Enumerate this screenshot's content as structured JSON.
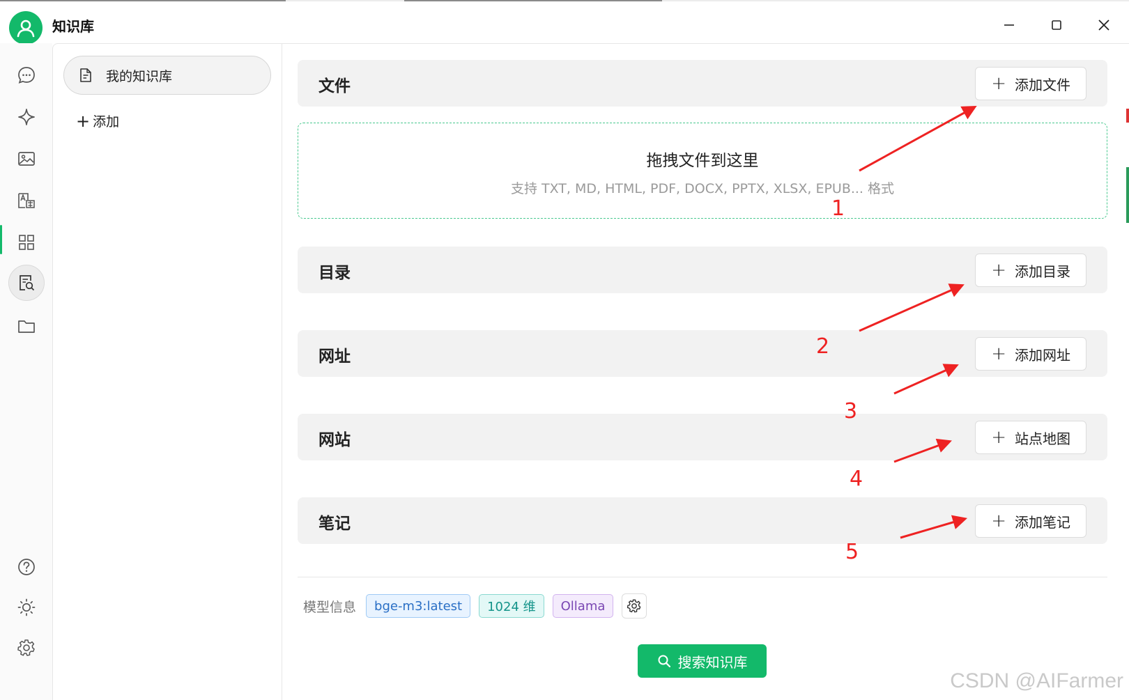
{
  "window": {
    "title": "知识库",
    "controls": [
      "minimize-icon",
      "maximize-icon",
      "close-icon"
    ]
  },
  "rail": {
    "items": [
      {
        "icon": "chat-icon"
      },
      {
        "icon": "sparkle-icon"
      },
      {
        "icon": "image-icon"
      },
      {
        "icon": "translate-icon"
      },
      {
        "icon": "apps-grid-icon"
      },
      {
        "icon": "knowledge-search-icon",
        "active": true
      },
      {
        "icon": "folder-icon"
      }
    ],
    "bottom": [
      {
        "icon": "help-icon"
      },
      {
        "icon": "theme-sun-icon"
      },
      {
        "icon": "settings-gear-icon"
      }
    ]
  },
  "sidebar": {
    "kb_item_label": "我的知识库",
    "add_label": "添加"
  },
  "sections": {
    "files": {
      "title": "文件",
      "button": "添加文件"
    },
    "directory": {
      "title": "目录",
      "button": "添加目录"
    },
    "url": {
      "title": "网址",
      "button": "添加网址"
    },
    "website": {
      "title": "网站",
      "button": "站点地图"
    },
    "notes": {
      "title": "笔记",
      "button": "添加笔记"
    }
  },
  "dropzone": {
    "title": "拖拽文件到这里",
    "subtitle": "支持 TXT, MD, HTML, PDF, DOCX, PPTX, XLSX, EPUB... 格式"
  },
  "model_info": {
    "label": "模型信息",
    "model": "bge-m3:latest",
    "dimensions": "1024 维",
    "provider": "Ollama"
  },
  "search_button": "搜索知识库",
  "annotations": [
    "1",
    "2",
    "3",
    "4",
    "5"
  ],
  "watermark": "CSDN @AIFarmer",
  "colors": {
    "accent": "#13b96a",
    "annotation": "#ee2222",
    "dropzone_border": "#49c98f"
  }
}
